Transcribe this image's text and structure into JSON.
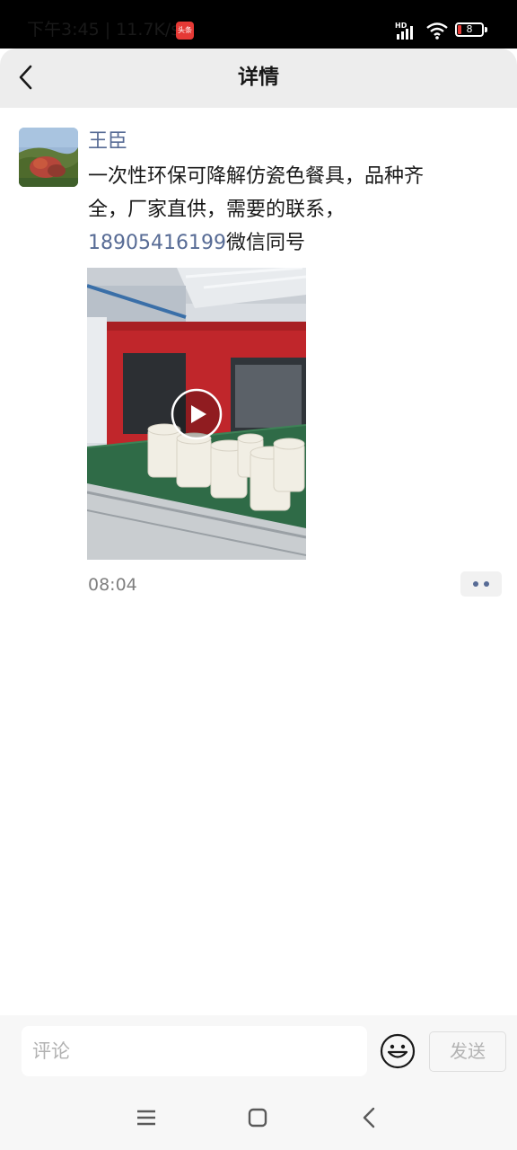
{
  "status_bar": {
    "time": "下午3:45",
    "network_speed": "11.7K/s",
    "app_badge_icon": "toutiao-badge-icon",
    "hd_label": "HD",
    "battery": "8",
    "accent": "#e53935"
  },
  "header": {
    "title": "详情",
    "back_icon": "chevron-left-icon"
  },
  "post": {
    "author": "王臣",
    "text_before_phone": "一次性环保可降解仿瓷色餐具，品种齐全，厂家直供，需要的联系，",
    "phone": "18905416199",
    "text_after_phone": "微信同号",
    "timestamp": "08:04",
    "media_type": "video",
    "link_color": "#576b95"
  },
  "comment_bar": {
    "placeholder": "评论",
    "send_label": "发送",
    "emoji_icon": "smiley-icon"
  },
  "system_nav": {
    "menu_icon": "menu-icon",
    "home_icon": "home-square-icon",
    "back_icon": "back-triangle-icon"
  }
}
